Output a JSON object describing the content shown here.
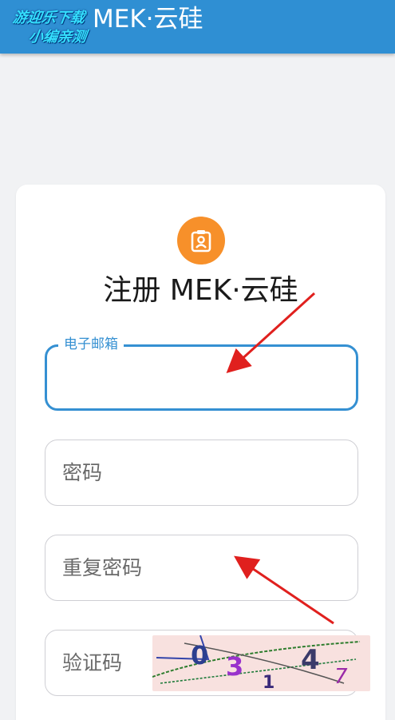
{
  "header": {
    "title": "MEK·云硅",
    "watermark_line1": "游迎乐下载",
    "watermark_line2": "小编亲测"
  },
  "card": {
    "icon": "contact-card-icon",
    "title": "注册 MEK·云硅"
  },
  "form": {
    "email_label": "电子邮箱",
    "email_value": "",
    "password_placeholder": "密码",
    "repeat_password_placeholder": "重复密码",
    "captcha_placeholder": "验证码",
    "captcha_text": "0 3 1 4 7"
  },
  "colors": {
    "header_bg": "#2f8fd3",
    "accent": "#3590d2",
    "avatar_bg": "#f7902a",
    "annotation_arrow": "#e0201e"
  }
}
